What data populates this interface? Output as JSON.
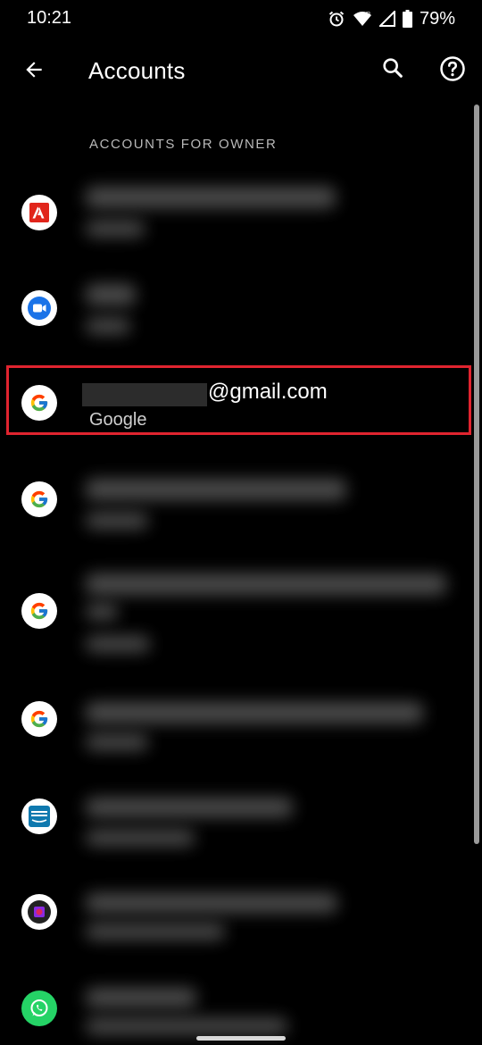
{
  "status_bar": {
    "time": "10:21",
    "battery": "79%",
    "icons": [
      "alarm-icon",
      "wifi-icon",
      "signal-icon",
      "battery-icon"
    ]
  },
  "app_bar": {
    "title": "Accounts",
    "icons": [
      "back-arrow-icon",
      "search-icon",
      "help-icon"
    ]
  },
  "section": {
    "header": "ACCOUNTS FOR OWNER"
  },
  "accounts": {
    "adobe": {
      "icon": "adobe-icon"
    },
    "duo": {
      "icon": "google-duo-icon"
    },
    "highlighted": {
      "icon": "google-icon",
      "email_suffix": "@gmail.com",
      "provider": "Google"
    },
    "google_2": {
      "icon": "google-icon"
    },
    "google_3": {
      "icon": "google-icon"
    },
    "google_4": {
      "icon": "google-icon"
    },
    "prime_video": {
      "icon": "prime-video-icon"
    },
    "app_8": {
      "icon": "app-icon"
    },
    "whatsapp": {
      "icon": "whatsapp-icon"
    }
  },
  "colors": {
    "background": "#000000",
    "highlight": "#e0242f",
    "adobe_red": "#e1251b",
    "duo_blue": "#1a73e8",
    "whatsapp_green": "#25d366"
  }
}
